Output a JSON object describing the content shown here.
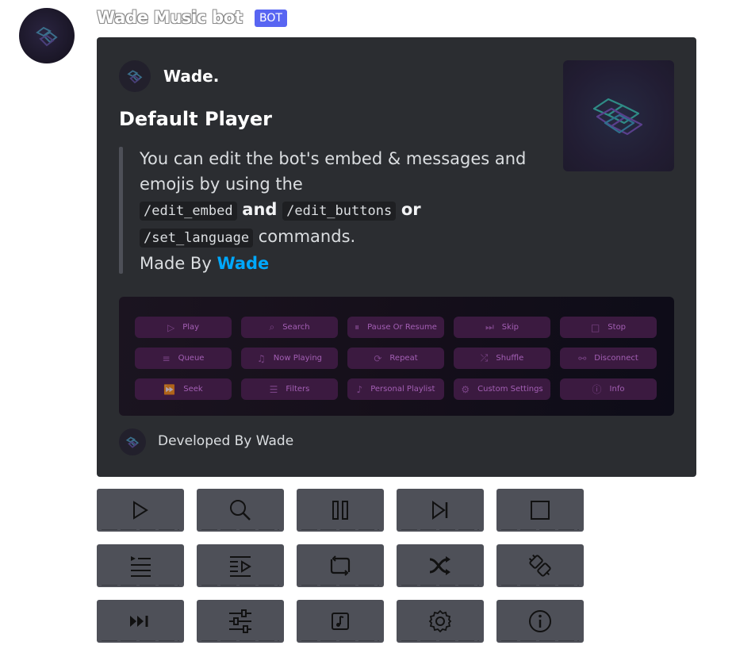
{
  "message": {
    "username": "Wade Music bot",
    "badge": "BOT"
  },
  "embed": {
    "author": "Wade.",
    "title": "Default Player",
    "description": {
      "line1": "You can edit the bot's embed & messages and emojis by using the",
      "cmd1": "/edit_embed",
      "and": "and",
      "cmd2": "/edit_buttons",
      "or": "or",
      "cmd3": "/set_language",
      "commands": "commands.",
      "made_by": "Made By",
      "made_by_link": "Wade"
    },
    "image_buttons": [
      {
        "label": "Play",
        "icon": "play-icon"
      },
      {
        "label": "Search",
        "icon": "search-icon"
      },
      {
        "label": "Pause Or Resume",
        "icon": "pause-icon"
      },
      {
        "label": "Skip",
        "icon": "skip-icon"
      },
      {
        "label": "Stop",
        "icon": "stop-icon"
      },
      {
        "label": "Queue",
        "icon": "queue-icon"
      },
      {
        "label": "Now Playing",
        "icon": "now-playing-icon"
      },
      {
        "label": "Repeat",
        "icon": "repeat-icon"
      },
      {
        "label": "Shuffle",
        "icon": "shuffle-icon"
      },
      {
        "label": "Disconnect",
        "icon": "disconnect-icon"
      },
      {
        "label": "Seek",
        "icon": "seek-icon"
      },
      {
        "label": "Filters",
        "icon": "filters-icon"
      },
      {
        "label": "Personal Playlist",
        "icon": "playlist-icon"
      },
      {
        "label": "Custom Settings",
        "icon": "settings-icon"
      },
      {
        "label": "Info",
        "icon": "info-icon"
      }
    ],
    "footer": "Developed By Wade"
  },
  "buttons": [
    {
      "name": "play-button",
      "icon": "play-icon"
    },
    {
      "name": "search-button",
      "icon": "search-icon"
    },
    {
      "name": "pause-resume-button",
      "icon": "pause-icon"
    },
    {
      "name": "skip-button",
      "icon": "skip-icon"
    },
    {
      "name": "stop-button",
      "icon": "stop-icon"
    },
    {
      "name": "queue-button",
      "icon": "queue-icon"
    },
    {
      "name": "now-playing-button",
      "icon": "now-playing-icon"
    },
    {
      "name": "repeat-button",
      "icon": "repeat-icon"
    },
    {
      "name": "shuffle-button",
      "icon": "shuffle-icon"
    },
    {
      "name": "disconnect-button",
      "icon": "disconnect-icon"
    },
    {
      "name": "seek-button",
      "icon": "seek-icon"
    },
    {
      "name": "filters-button",
      "icon": "filters-icon"
    },
    {
      "name": "playlist-button",
      "icon": "playlist-icon"
    },
    {
      "name": "settings-button",
      "icon": "settings-icon"
    },
    {
      "name": "info-button",
      "icon": "info-icon"
    }
  ],
  "colors": {
    "embed_bg": "#2b2d31",
    "button_bg": "#4e5058",
    "bot_badge": "#5865f2",
    "link": "#00a8fc"
  }
}
